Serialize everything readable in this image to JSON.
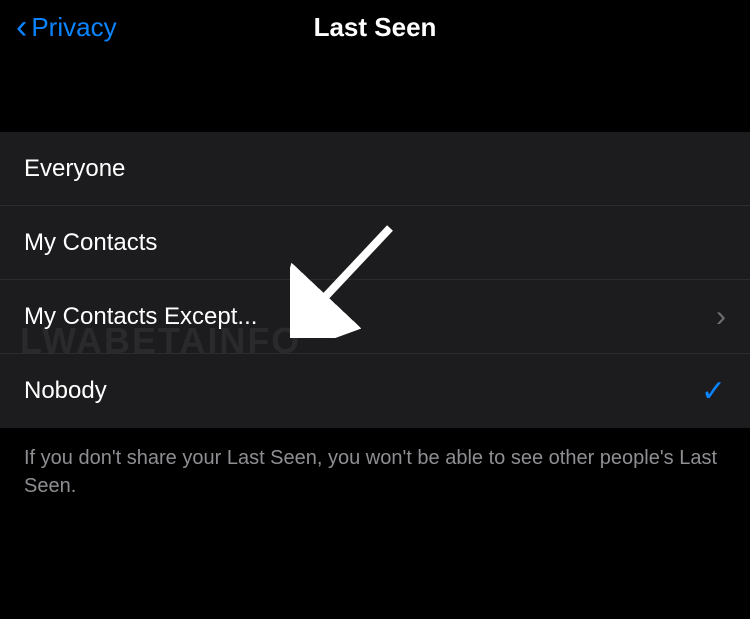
{
  "nav": {
    "back_label": "Privacy",
    "title": "Last Seen"
  },
  "options": [
    {
      "label": "Everyone",
      "selected": false,
      "disclosure": false
    },
    {
      "label": "My Contacts",
      "selected": false,
      "disclosure": false
    },
    {
      "label": "My Contacts Except...",
      "selected": false,
      "disclosure": true
    },
    {
      "label": "Nobody",
      "selected": true,
      "disclosure": false
    }
  ],
  "footer": "If you don't share your Last Seen, you won't be able to see other people's Last Seen.",
  "watermark": "LWABETAINFO"
}
